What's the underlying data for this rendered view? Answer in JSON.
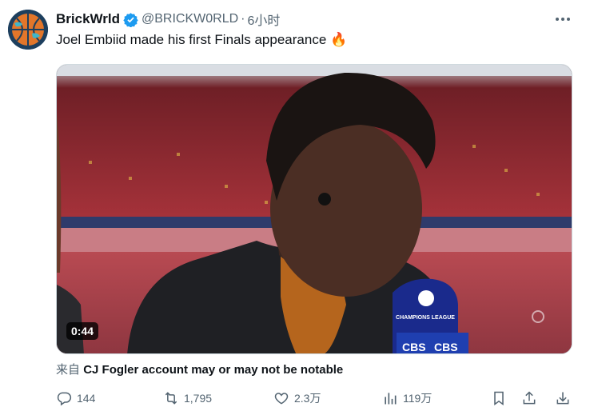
{
  "author": {
    "display_name": "BrickWrld",
    "handle": "@BRICKW0RLD",
    "separator": "·",
    "time": "6小时",
    "avatar_icon": "basketball-globe-avatar",
    "verified_color": "#1d9bf0"
  },
  "tweet": {
    "text": "Joel Embiid made his first Finals appearance",
    "emoji": "🔥"
  },
  "media": {
    "type": "video",
    "duration": "0:44",
    "mic_brand": "CHAMPIONS LEAGUE",
    "mic_network": "CBS"
  },
  "source": {
    "prefix": "来自",
    "app": "CJ Fogler account may or may not be notable"
  },
  "actions": {
    "replies": "144",
    "reposts": "1,795",
    "likes": "2.3万",
    "views": "119万"
  },
  "colors": {
    "text": "#0f1419",
    "secondary": "#536471",
    "accent": "#1d9bf0"
  }
}
